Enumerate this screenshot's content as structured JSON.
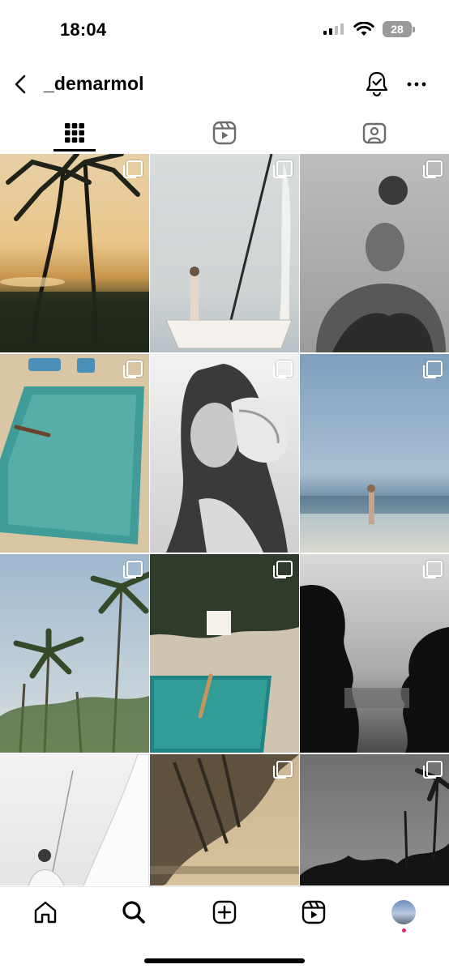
{
  "status_bar": {
    "time": "18:04",
    "battery": "28"
  },
  "header": {
    "username": "_demarmol"
  },
  "tabs": [
    {
      "name": "posts",
      "icon": "grid-icon",
      "active": true
    },
    {
      "name": "reels",
      "icon": "reels-icon",
      "active": false
    },
    {
      "name": "tagged",
      "icon": "tagged-icon",
      "active": false
    }
  ],
  "grid": [
    {
      "subject": "palm trees at sunset",
      "multi": true
    },
    {
      "subject": "sailboat with woman",
      "multi": true
    },
    {
      "subject": "woman holding coconut",
      "multi": true
    },
    {
      "subject": "pool diver",
      "multi": true
    },
    {
      "subject": "woman with conch shell",
      "multi": true
    },
    {
      "subject": "woman walking in sea",
      "multi": true
    },
    {
      "subject": "palm trees sky",
      "multi": true
    },
    {
      "subject": "swimmer in pool",
      "multi": true
    },
    {
      "subject": "silhouette faces ocean",
      "multi": true
    },
    {
      "subject": "sail and woman",
      "multi": true
    },
    {
      "subject": "palm leaves sunset",
      "multi": true
    },
    {
      "subject": "palms bw sky",
      "multi": true
    }
  ],
  "bottom_nav": [
    "home-icon",
    "search-icon",
    "create-icon",
    "reels-icon",
    "profile-avatar"
  ],
  "colors": {
    "accent_dot": "#e0245e",
    "active_tab": "#000000"
  }
}
